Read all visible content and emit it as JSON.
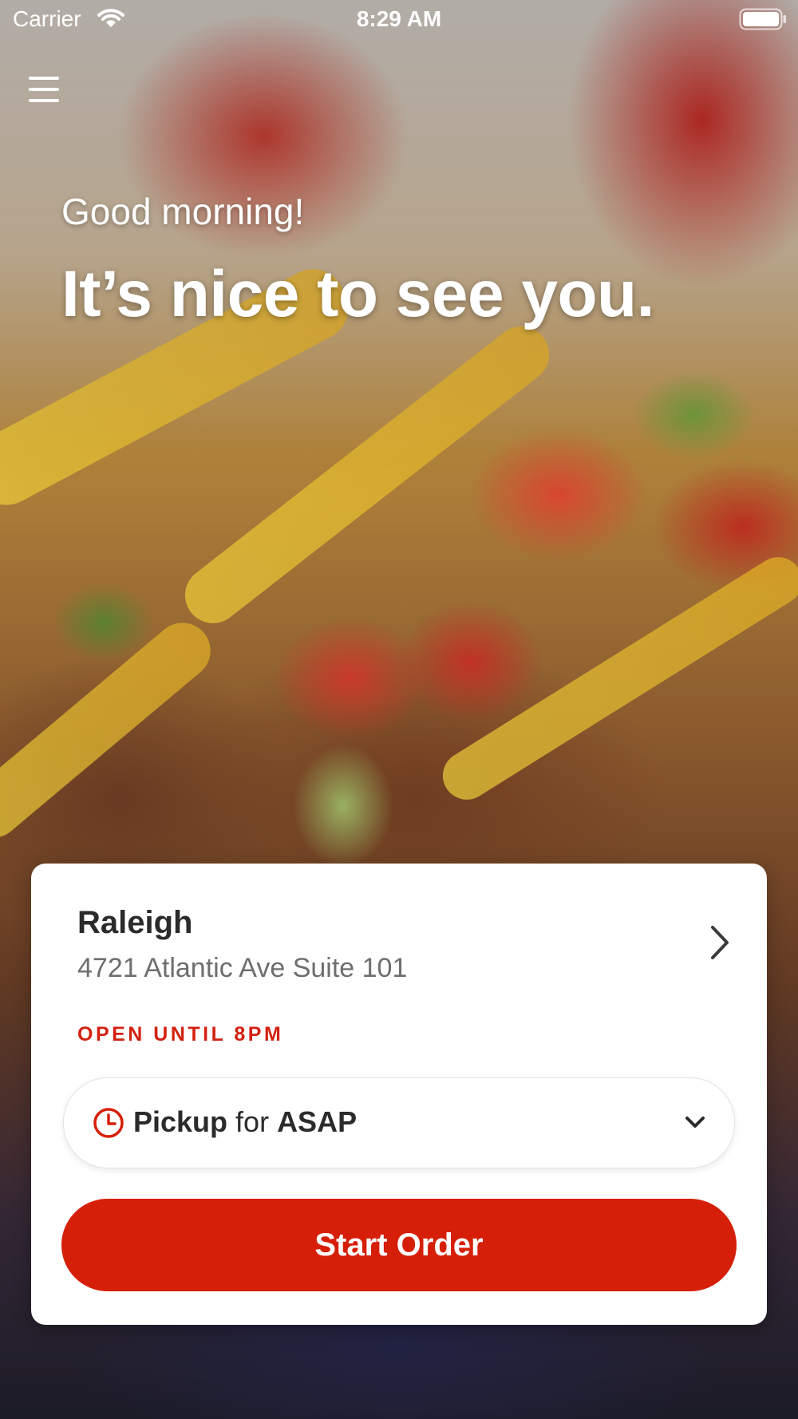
{
  "status_bar": {
    "carrier": "Carrier",
    "time": "8:29 AM"
  },
  "hero": {
    "greeting": "Good morning!",
    "headline": "It’s nice to see you."
  },
  "store": {
    "name": "Raleigh",
    "address": "4721 Atlantic Ave Suite 101",
    "status": "OPEN UNTIL 8PM"
  },
  "order_mode": {
    "method": "Pickup",
    "connector": "for",
    "time": "ASAP"
  },
  "start_button": {
    "label": "Start Order"
  },
  "colors": {
    "accent": "#d61f08",
    "status_text": "#d32010",
    "card": "#ffffff"
  },
  "icons": [
    "menu-icon",
    "wifi-icon",
    "battery-icon",
    "chevron-right-icon",
    "clock-icon",
    "chevron-down-icon"
  ]
}
